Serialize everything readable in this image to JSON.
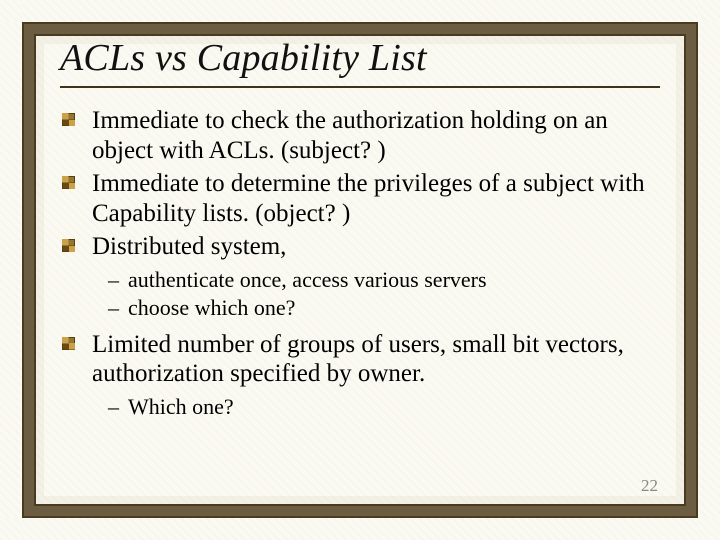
{
  "title": "ACLs vs Capability List",
  "bullets": {
    "b1": "Immediate to check the authorization holding on an object with ACLs.  (subject? )",
    "b2": "Immediate to determine the privileges of a subject with Capability lists. (object? )",
    "b3": "Distributed system,",
    "b3_sub": {
      "s1": "authenticate once,  access various servers",
      "s2": " choose which one?"
    },
    "b4": "Limited number of groups of users, small bit vectors, authorization specified by owner.",
    "b4_sub": {
      "s1": " Which one?"
    }
  },
  "page_number": "22"
}
